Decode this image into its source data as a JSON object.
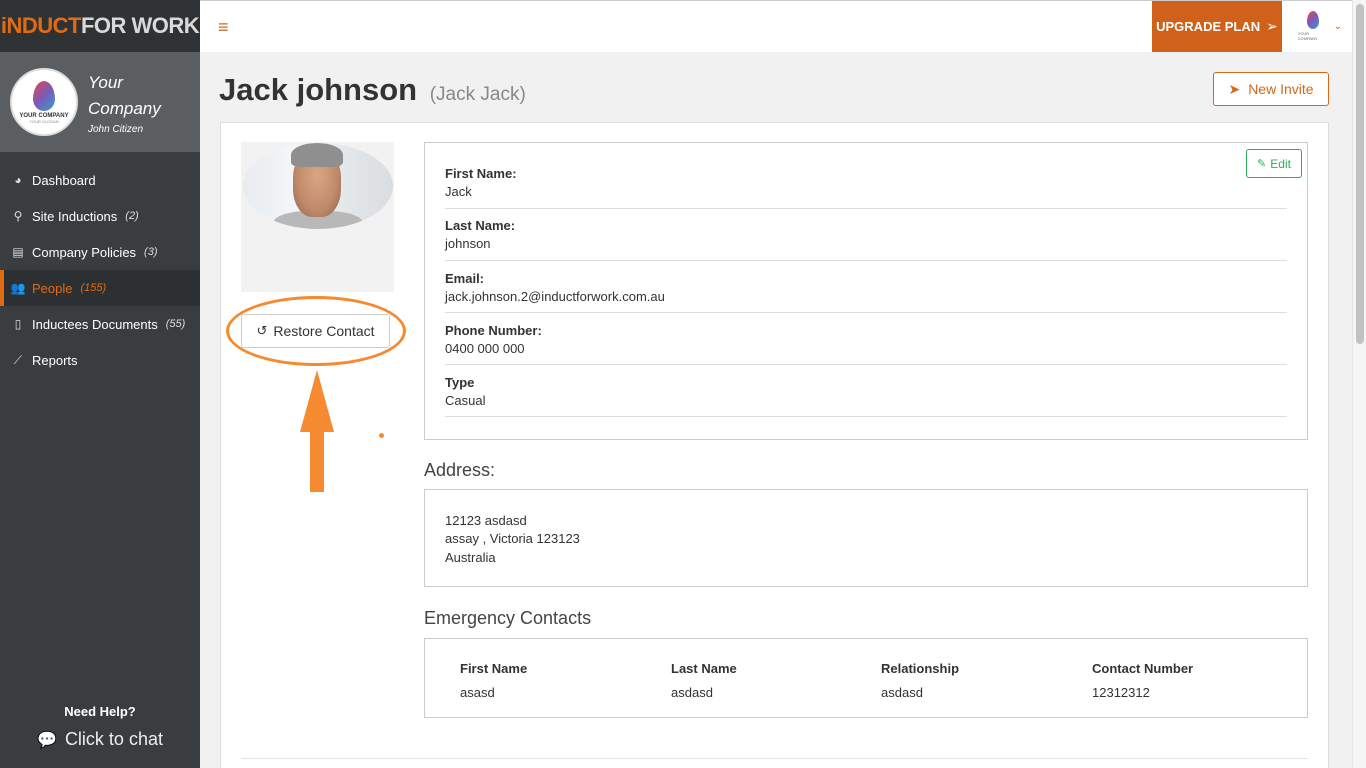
{
  "brand": {
    "part1": "iNDUCT",
    "part2": "FOR WORK"
  },
  "company": {
    "name": "Your Company",
    "user": "John Citizen",
    "logo_line1": "YOUR COMPANY",
    "logo_line2": "YOUR SLOGAN"
  },
  "nav": [
    {
      "label": "Dashboard",
      "count": "",
      "icon": "dashboard-icon"
    },
    {
      "label": "Site Inductions",
      "count": "(2)",
      "icon": "map-marker-icon"
    },
    {
      "label": "Company Policies",
      "count": "(3)",
      "icon": "book-icon"
    },
    {
      "label": "People",
      "count": "(155)",
      "icon": "people-icon",
      "active": true
    },
    {
      "label": "Inductees Documents",
      "count": "(55)",
      "icon": "document-icon"
    },
    {
      "label": "Reports",
      "count": "",
      "icon": "chart-icon"
    }
  ],
  "help": {
    "title": "Need Help?",
    "chat": "Click to chat"
  },
  "topbar": {
    "upgrade": "UPGRADE PLAN"
  },
  "page": {
    "title": "Jack johnson",
    "subtitle": "(Jack Jack)",
    "new_invite": "New Invite"
  },
  "actions": {
    "restore": "Restore Contact",
    "edit": "Edit"
  },
  "fields": [
    {
      "label": "First Name:",
      "value": "Jack"
    },
    {
      "label": "Last Name:",
      "value": "johnson"
    },
    {
      "label": "Email:",
      "value": "jack.johnson.2@inductforwork.com.au"
    },
    {
      "label": "Phone Number:",
      "value": "0400 000 000"
    },
    {
      "label": "Type",
      "value": "Casual"
    }
  ],
  "address": {
    "title": "Address:",
    "line1": "12123   asdasd",
    "line2": "assay ,   Victoria   123123",
    "line3": "Australia"
  },
  "emergency": {
    "title": "Emergency Contacts",
    "headers": [
      "First Name",
      "Last Name",
      "Relationship",
      "Contact Number"
    ],
    "rows": [
      [
        "asasd",
        "asdasd",
        "asdasd",
        "12312312"
      ]
    ]
  },
  "colors": {
    "accent": "#d0611a",
    "success": "#2ab05c",
    "annotation": "#f58a30"
  }
}
